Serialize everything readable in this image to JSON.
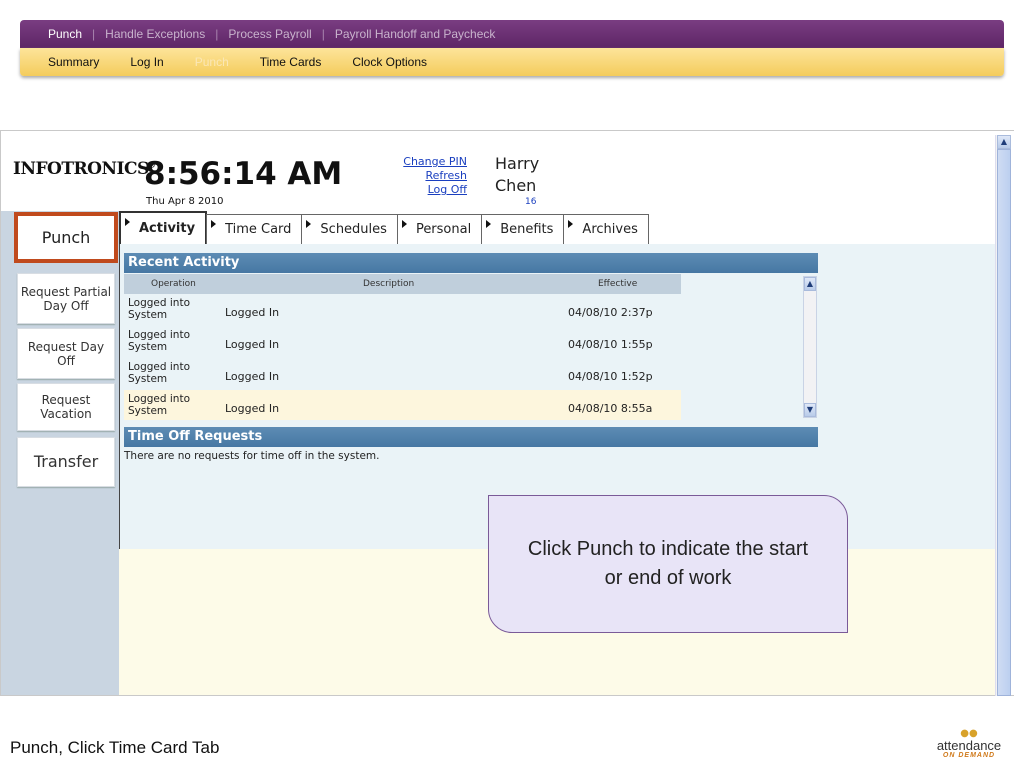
{
  "top_nav": {
    "items": [
      {
        "label": "Punch"
      },
      {
        "label": "Handle Exceptions"
      },
      {
        "label": "Process Payroll"
      },
      {
        "label": "Payroll Handoff and Paycheck"
      }
    ]
  },
  "sub_nav": {
    "items": [
      {
        "label": "Summary"
      },
      {
        "label": "Log In"
      },
      {
        "label": "Punch"
      },
      {
        "label": "Time Cards"
      },
      {
        "label": "Clock Options"
      }
    ]
  },
  "app": {
    "logo": "INFOTRONICS",
    "logo_mark": "®",
    "clock_time": "8:56:14 AM",
    "clock_date": "Thu Apr 8 2010",
    "links": {
      "change_pin": "Change PIN",
      "refresh": "Refresh",
      "log_off": "Log Off"
    },
    "user": {
      "first": "Harry",
      "last": "Chen",
      "id": "16"
    }
  },
  "sidebar": {
    "punch": "Punch",
    "items": [
      {
        "label": "Request Partial Day Off"
      },
      {
        "label": "Request Day Off"
      },
      {
        "label": "Request Vacation"
      },
      {
        "label": "Transfer"
      }
    ]
  },
  "tabs": [
    {
      "label": "Activity"
    },
    {
      "label": "Time Card"
    },
    {
      "label": "Schedules"
    },
    {
      "label": "Personal"
    },
    {
      "label": "Benefits"
    },
    {
      "label": "Archives"
    }
  ],
  "recent_activity": {
    "title": "Recent Activity",
    "columns": {
      "operation": "Operation",
      "description": "Description",
      "effective": "Effective"
    },
    "rows": [
      {
        "operation": "Logged into System",
        "description": "Logged In",
        "effective": "04/08/10 2:37p"
      },
      {
        "operation": "Logged into System",
        "description": "Logged In",
        "effective": "04/08/10 1:55p"
      },
      {
        "operation": "Logged into System",
        "description": "Logged In",
        "effective": "04/08/10 1:52p"
      },
      {
        "operation": "Logged into System",
        "description": "Logged In",
        "effective": "04/08/10 8:55a"
      }
    ]
  },
  "time_off": {
    "title": "Time Off Requests",
    "empty_text": "There are no requests for time off in the system."
  },
  "callout": {
    "text": "Click Punch to indicate the start or end of work"
  },
  "caption": "Punch, Click Time Card Tab",
  "brand": {
    "name": "attendance",
    "tagline": "ON DEMAND"
  },
  "colors": {
    "accent_purple": "#6b2c73",
    "accent_gold": "#f7d36b",
    "punch_border": "#c04a1d",
    "section_header": "#4f7fab"
  }
}
